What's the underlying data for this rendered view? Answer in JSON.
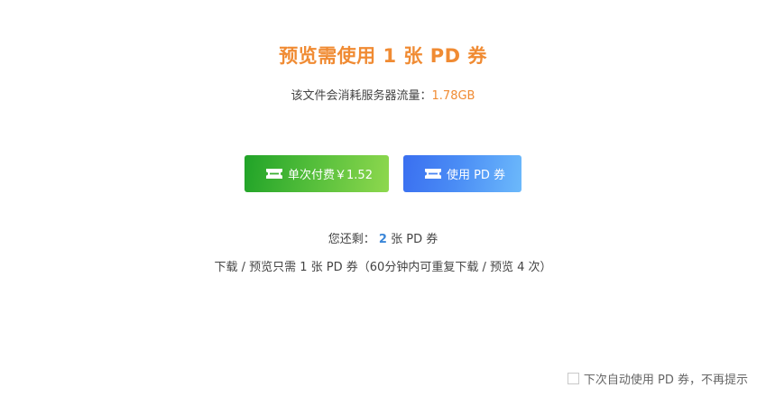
{
  "header": {
    "title": "预览需使用 1 张 PD 券",
    "traffic_label": "该文件会消耗服务器流量：",
    "traffic_value": "1.78GB"
  },
  "buttons": {
    "pay_label": "单次付费￥1.52",
    "coupon_label": "使用 PD 券"
  },
  "balance": {
    "label": "您还剩：",
    "count": "2",
    "unit": "张 PD 券"
  },
  "note": "下载 / 预览只需 1 张 PD 券（60分钟内可重复下载 / 预览 4 次）",
  "auto_use": {
    "label": "下次自动使用 PD 券，不再提示",
    "checked": false
  },
  "icons": {
    "pay": "ticket-icon",
    "coupon": "ticket-icon"
  },
  "colors": {
    "accent_orange": "#f08b33",
    "pay_green": "#52bd3a",
    "coupon_blue": "#4a8cf5",
    "count_blue": "#3a86d8"
  }
}
